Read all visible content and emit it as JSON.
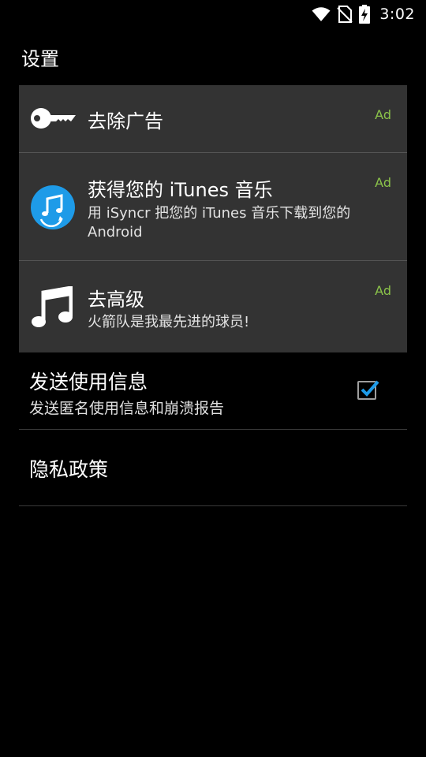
{
  "status_bar": {
    "time": "3:02",
    "icons": [
      "wifi-icon",
      "no-sim-icon",
      "battery-charging-icon"
    ]
  },
  "page_title": "设置",
  "ads": [
    {
      "title": "去除广告",
      "subtitle": "",
      "badge": "Ad",
      "icon": "key-icon"
    },
    {
      "title": "获得您的 iTunes 音乐",
      "subtitle": "用 iSyncr 把您的 iTunes 音乐下载到您的 Android",
      "badge": "Ad",
      "icon": "isyncr-music-sync-icon"
    },
    {
      "title": "去高级",
      "subtitle": "火箭队是我最先进的球员!",
      "badge": "Ad",
      "icon": "music-note-icon"
    }
  ],
  "preferences": {
    "send_usage": {
      "title": "发送使用信息",
      "subtitle": "发送匿名使用信息和崩溃报告",
      "checked": true
    },
    "privacy": {
      "title": "隐私政策"
    }
  },
  "colors": {
    "background": "#000000",
    "card": "#333333",
    "ad_badge": "#8bc34a",
    "accent_blue": "#1e9be8"
  }
}
